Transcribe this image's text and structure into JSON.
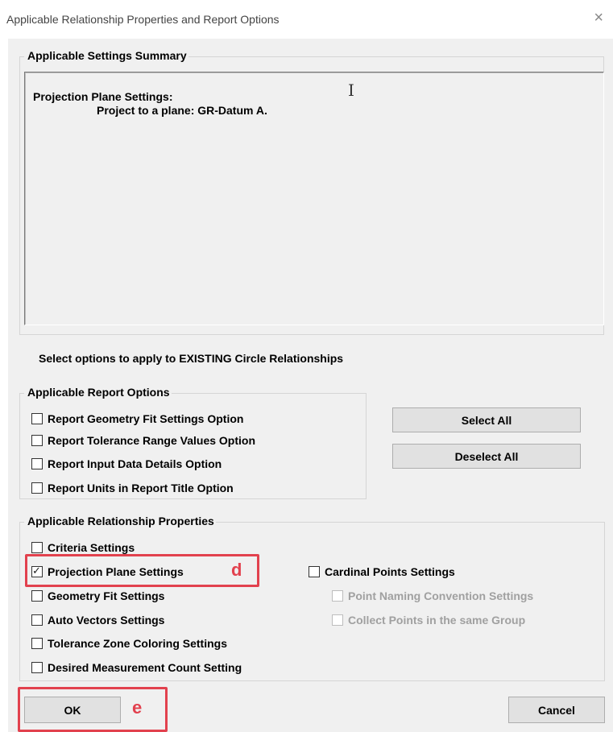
{
  "window": {
    "title": "Applicable Relationship Properties and Report Options",
    "close_glyph": "×"
  },
  "summary": {
    "label": "Applicable Settings Summary",
    "lines": [
      "Projection Plane Settings:",
      "Project to a plane:  GR-Datum A."
    ],
    "cursor_glyph": "I"
  },
  "instruction": "Select options to apply to EXISTING Circle Relationships",
  "report_options": {
    "label": "Applicable Report Options",
    "items": [
      {
        "label": "Report Geometry Fit Settings Option",
        "checked": false
      },
      {
        "label": "Report Tolerance Range Values Option",
        "checked": false
      },
      {
        "label": "Report Input Data Details Option",
        "checked": false
      },
      {
        "label": "Report Units in Report Title Option",
        "checked": false
      }
    ]
  },
  "buttons": {
    "select_all": "Select All",
    "deselect_all": "Deselect All",
    "ok": "OK",
    "cancel": "Cancel"
  },
  "properties": {
    "label": "Applicable Relationship Properties",
    "left_items": [
      {
        "label": "Criteria Settings",
        "checked": false
      },
      {
        "label": "Projection Plane Settings",
        "checked": true
      },
      {
        "label": "Geometry Fit Settings",
        "checked": false
      },
      {
        "label": "Auto Vectors Settings",
        "checked": false
      },
      {
        "label": "Tolerance Zone Coloring Settings",
        "checked": false
      },
      {
        "label": "Desired Measurement Count Setting",
        "checked": false
      }
    ],
    "right_items": [
      {
        "label": "Cardinal Points Settings",
        "checked": false,
        "enabled": true
      },
      {
        "label": "Point Naming Convention Settings",
        "checked": false,
        "enabled": false
      },
      {
        "label": "Collect Points in the same Group",
        "checked": false,
        "enabled": false
      }
    ]
  },
  "annotations": {
    "marker_d": "d",
    "marker_e": "e",
    "color": "#e2414e"
  }
}
